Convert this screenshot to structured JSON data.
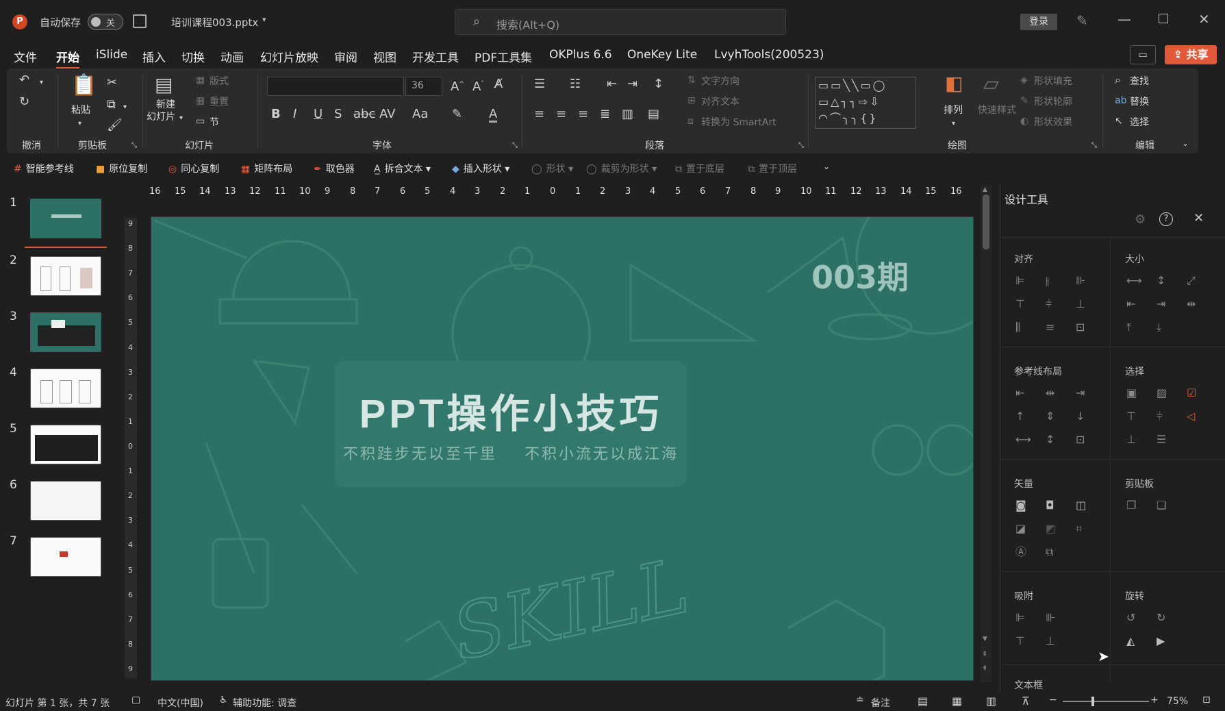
{
  "titlebar": {
    "autosave_label": "自动保存",
    "autosave_state": "关",
    "file_name": "培训课程003.pptx",
    "search_placeholder": "搜索(Alt+Q)",
    "login_label": "登录"
  },
  "menu": {
    "items": [
      "文件",
      "开始",
      "iSlide",
      "插入",
      "切换",
      "动画",
      "幻灯片放映",
      "审阅",
      "视图",
      "开发工具",
      "PDF工具集",
      "OKPlus 6.6",
      "OneKey Lite",
      "LvyhTools(200523)"
    ],
    "share_label": "共享"
  },
  "ribbon": {
    "groups": {
      "undo": "撤消",
      "clipboard": "剪贴板",
      "slides": "幻灯片",
      "font": "字体",
      "paragraph": "段落",
      "drawing": "绘图",
      "editing": "编辑"
    },
    "paste": "粘贴",
    "new_slide_line1": "新建",
    "new_slide_line2": "幻灯片",
    "layout": "版式",
    "reset": "重置",
    "section": "节",
    "font_size": "36",
    "text_direction": "文字方向",
    "align_text": "对齐文本",
    "convert_smartart": "转换为 SmartArt",
    "arrange": "排列",
    "quick_styles": "快速样式",
    "shape_fill": "形状填充",
    "shape_outline": "形状轮廓",
    "shape_effects": "形状效果",
    "find": "查找",
    "replace": "替换",
    "select": "选择"
  },
  "toolbar2": {
    "items": [
      {
        "label": "智能参考线",
        "enabled": true
      },
      {
        "label": "原位复制",
        "enabled": true
      },
      {
        "label": "同心复制",
        "enabled": true
      },
      {
        "label": "矩阵布局",
        "enabled": true
      },
      {
        "label": "取色器",
        "enabled": true
      },
      {
        "label": "拆合文本",
        "enabled": true
      },
      {
        "label": "插入形状",
        "enabled": true
      },
      {
        "label": "形状",
        "enabled": false
      },
      {
        "label": "裁剪为形状",
        "enabled": false
      },
      {
        "label": "置于底层",
        "enabled": false
      },
      {
        "label": "置于顶层",
        "enabled": false
      }
    ]
  },
  "thumbnails": [
    "1",
    "2",
    "3",
    "4",
    "5",
    "6",
    "7"
  ],
  "ruler_h": [
    "16",
    "15",
    "14",
    "13",
    "12",
    "11",
    "10",
    "9",
    "8",
    "7",
    "6",
    "5",
    "4",
    "3",
    "2",
    "1",
    "0",
    "1",
    "2",
    "3",
    "4",
    "5",
    "6",
    "7",
    "8",
    "9",
    "10",
    "11",
    "12",
    "13",
    "14",
    "15",
    "16"
  ],
  "ruler_v": [
    "9",
    "8",
    "7",
    "6",
    "5",
    "4",
    "3",
    "2",
    "1",
    "0",
    "1",
    "2",
    "3",
    "4",
    "5",
    "6",
    "7",
    "8",
    "9"
  ],
  "slide": {
    "issue": "003期",
    "title": "PPT操作小技巧",
    "subtitle": "不积跬步无以至千里    不积小流无以成江海",
    "watermark": "SKILL",
    "bg_color": "#2d7166"
  },
  "panel": {
    "title": "设计工具",
    "sections": {
      "align": "对齐",
      "size": "大小",
      "guides": "参考线布局",
      "select": "选择",
      "vector": "矢量",
      "clipboard": "剪贴板",
      "snap": "吸附",
      "rotate": "旋转",
      "textbox": "文本框"
    }
  },
  "status": {
    "slide_info": "幻灯片 第 1 张，共 7 张",
    "language": "中文(中国)",
    "accessibility": "辅助功能: 调查",
    "notes": "备注",
    "zoom": "75%"
  },
  "colors": {
    "accent": "#e05a3a",
    "slide_bg": "#2d7166"
  }
}
